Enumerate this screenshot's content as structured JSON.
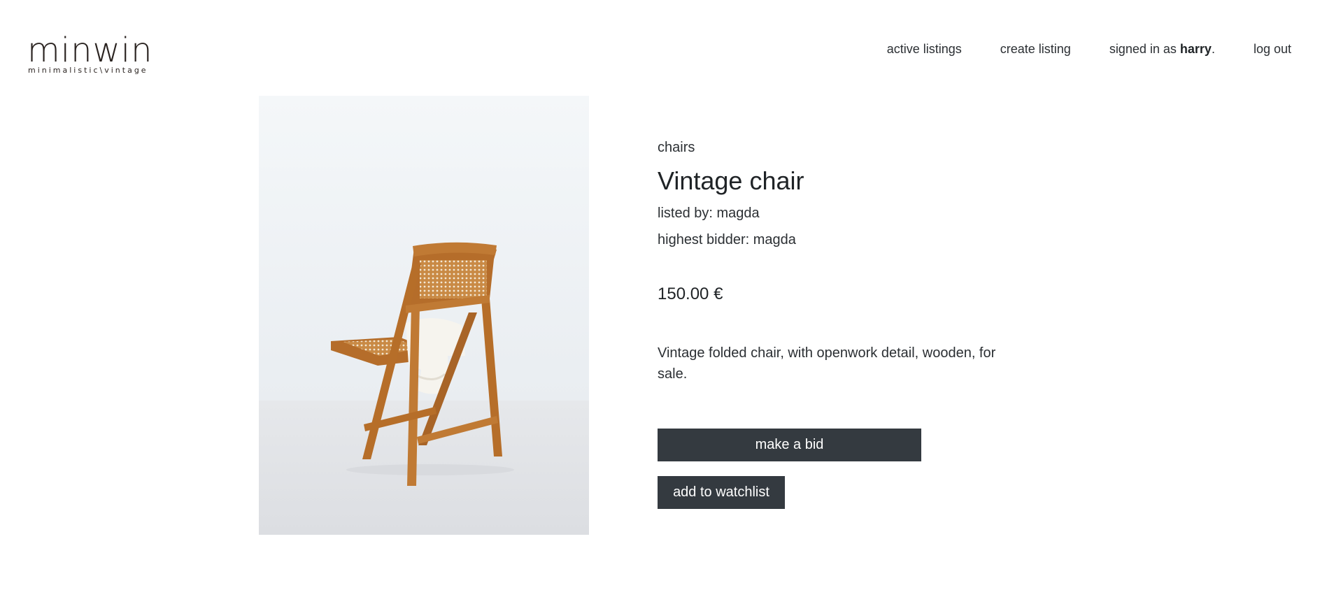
{
  "brand": {
    "name": "minwin",
    "tagline": "minimalistic\\vintage"
  },
  "nav": {
    "active_listings": "active listings",
    "create_listing": "create listing",
    "signed_in_prefix": "signed in as",
    "username": "harry",
    "signed_in_suffix": ".",
    "log_out": "log out"
  },
  "listing": {
    "category": "chairs",
    "title": "Vintage chair",
    "listed_by": "listed by: magda",
    "highest_bidder": "highest bidder: magda",
    "price": "150.00 €",
    "description": "Vintage folded chair, with openwork detail, wooden, for sale.",
    "image_subject": "wooden folding chair with cane seat and white sweater"
  },
  "actions": {
    "bid_label": "make a bid",
    "watch_label": "add to watchlist"
  },
  "colors": {
    "button_bg": "#343a40",
    "wood": "#b5722c",
    "photo_bg": "#eef1f4"
  }
}
